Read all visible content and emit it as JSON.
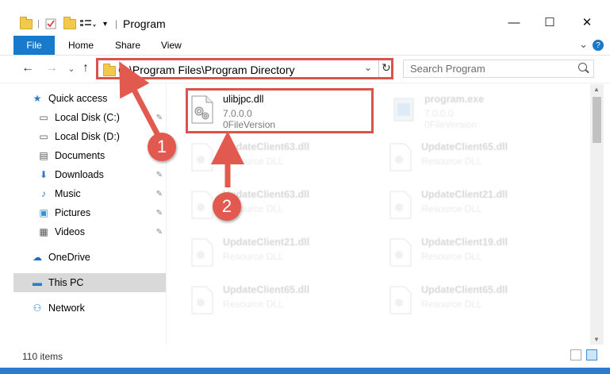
{
  "window": {
    "title": "Program",
    "minimize_glyph": "—",
    "maximize_glyph": "☐",
    "close_glyph": "✕"
  },
  "ribbon": {
    "file": "File",
    "home": "Home",
    "share": "Share",
    "view": "View",
    "help": "?"
  },
  "nav": {
    "back": "←",
    "forward": "→",
    "recent": "⌄",
    "up": "↑"
  },
  "address": {
    "path": "C:\\Program Files\\Program Directory",
    "dropdown": "⌄",
    "refresh": "↻"
  },
  "search": {
    "placeholder": "Search Program"
  },
  "sidebar": {
    "items": [
      {
        "label": "Quick access",
        "icon": "★",
        "pinned": false
      },
      {
        "label": "Local Disk (C:)",
        "icon": "▭",
        "pinned": true
      },
      {
        "label": "Local Disk (D:)",
        "icon": "▭",
        "pinned": false
      },
      {
        "label": "Documents",
        "icon": "▤",
        "pinned": false
      },
      {
        "label": "Downloads",
        "icon": "⬇",
        "pinned": true
      },
      {
        "label": "Music",
        "icon": "♪",
        "pinned": true
      },
      {
        "label": "Pictures",
        "icon": "▣",
        "pinned": true
      },
      {
        "label": "Videos",
        "icon": "▦",
        "pinned": true
      },
      {
        "label": "OneDrive",
        "icon": "☁",
        "pinned": false
      },
      {
        "label": "This PC",
        "icon": "▬",
        "pinned": false
      },
      {
        "label": "Network",
        "icon": "⚇",
        "pinned": false
      }
    ],
    "pin_glyph": "📌"
  },
  "files": {
    "featured": {
      "name": "ulibjpc.dll",
      "version": "7.0.0.0",
      "description": "0FileVersion"
    },
    "exe": {
      "name": "program.exe",
      "version": "7.0.0.0",
      "description": "0FileVersion"
    },
    "faded": [
      {
        "name": "UpdateClient63.dll",
        "desc": "Resource DLL"
      },
      {
        "name": "UpdateClient65.dll",
        "desc": "Resource DLL"
      },
      {
        "name": "UpdateClient63.dll",
        "desc": "Resource DLL"
      },
      {
        "name": "UpdateClient21.dll",
        "desc": "Resource DLL"
      },
      {
        "name": "UpdateClient21.dll",
        "desc": "Resource DLL"
      },
      {
        "name": "UpdateClient19.dll",
        "desc": "Resource DLL"
      },
      {
        "name": "UpdateClient65.dll",
        "desc": "Resource DLL"
      },
      {
        "name": "UpdateClient65.dll",
        "desc": "Resource DLL"
      }
    ]
  },
  "annotations": {
    "step1": "1",
    "step2": "2",
    "color": "#e25a4f"
  },
  "status": {
    "items": "110 items"
  },
  "colors": {
    "accent": "#1979ca",
    "annotation": "#d9534f",
    "selected_bg": "#d9d9d9"
  }
}
